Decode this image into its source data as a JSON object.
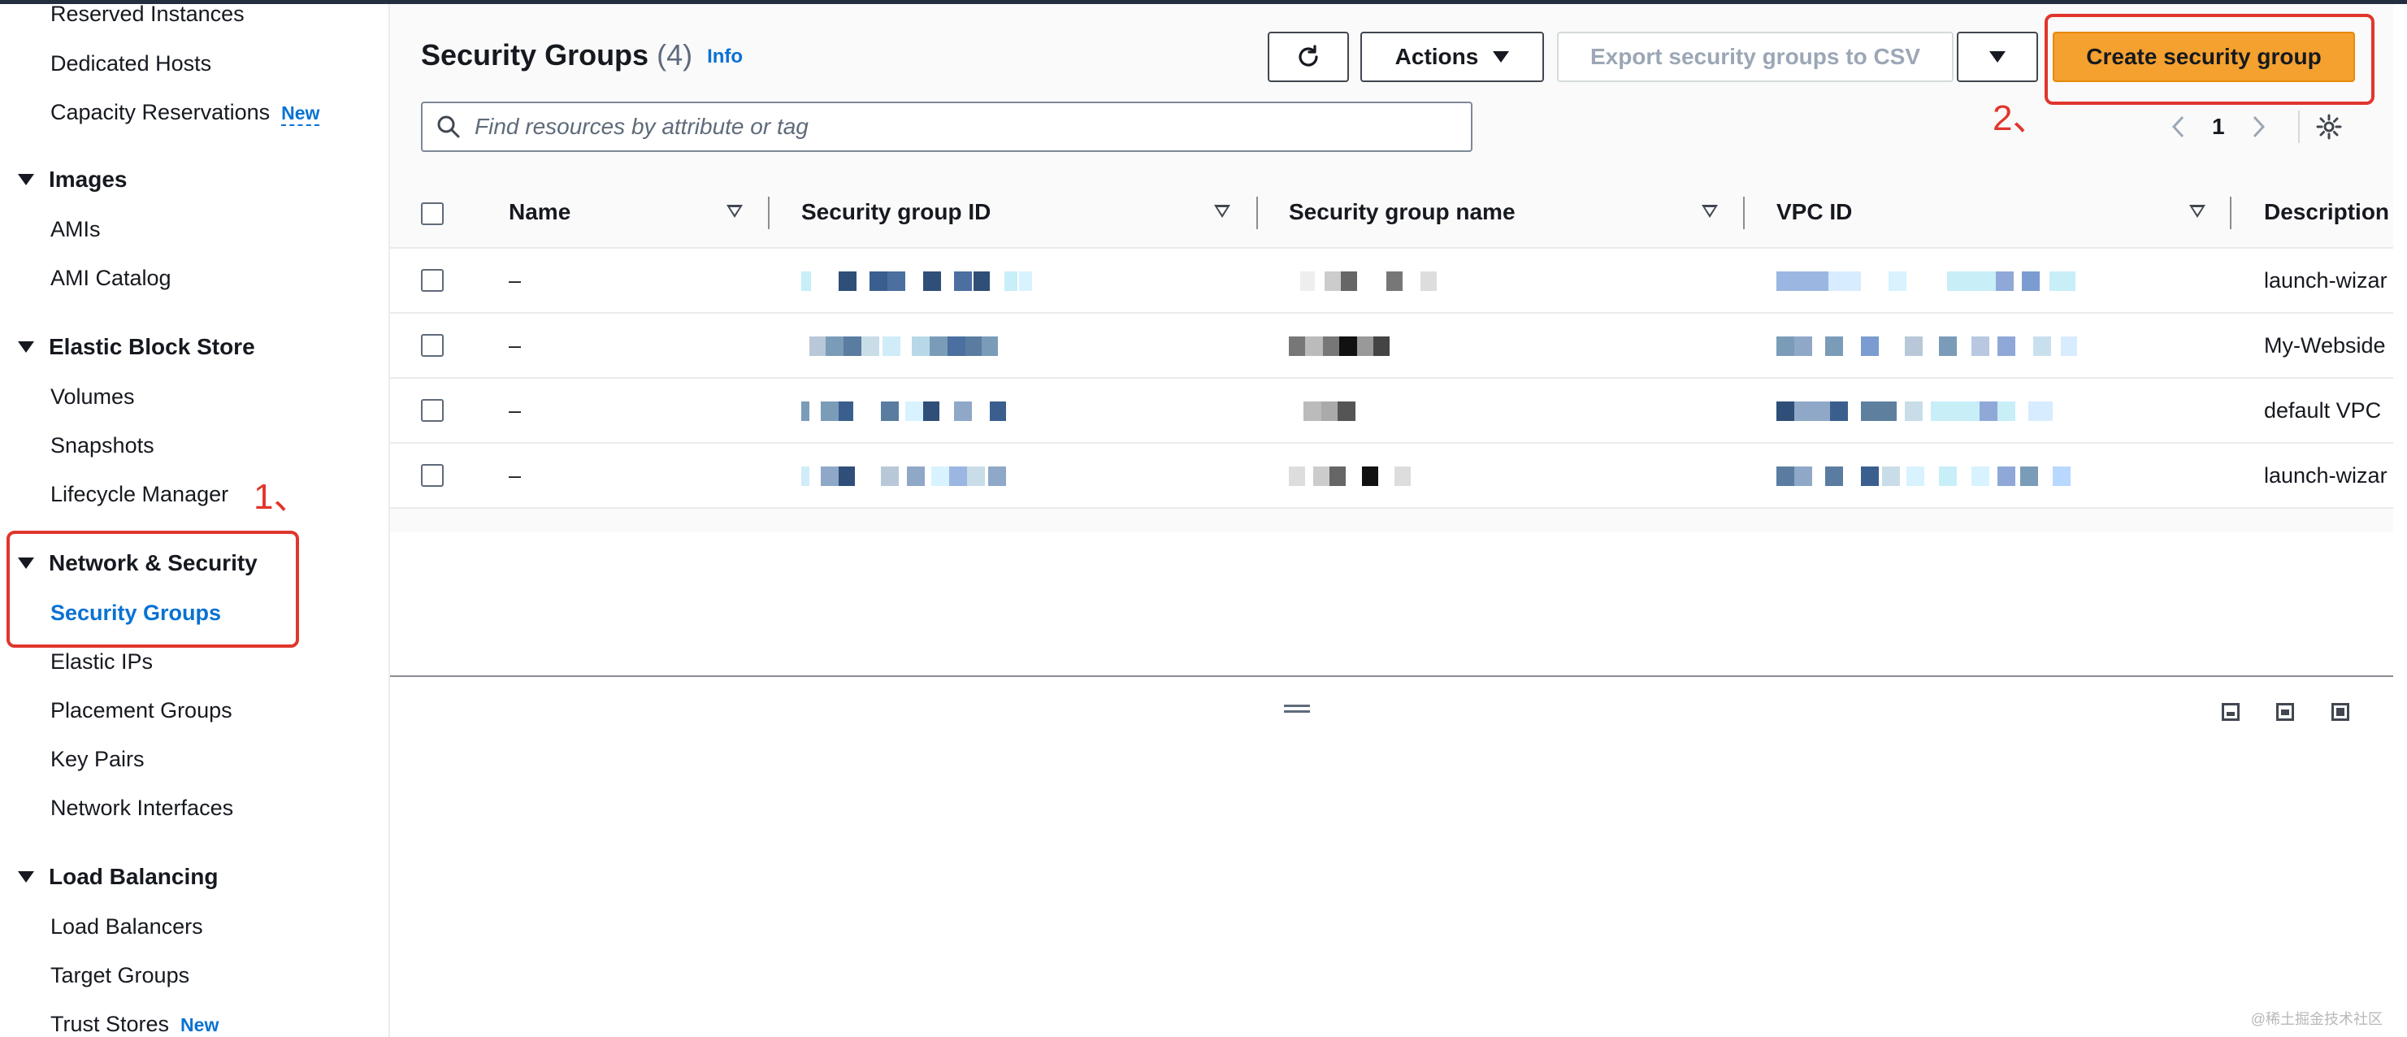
{
  "sidebar": {
    "items_top": [
      {
        "label": "Reserved Instances"
      },
      {
        "label": "Dedicated Hosts"
      },
      {
        "label": "Capacity Reservations",
        "badge": "New"
      }
    ],
    "sections": [
      {
        "title": "Images",
        "items": [
          "AMIs",
          "AMI Catalog"
        ]
      },
      {
        "title": "Elastic Block Store",
        "items": [
          "Volumes",
          "Snapshots",
          "Lifecycle Manager"
        ]
      },
      {
        "title": "Network & Security",
        "items": [
          "Security Groups",
          "Elastic IPs",
          "Placement Groups",
          "Key Pairs",
          "Network Interfaces"
        ]
      },
      {
        "title": "Load Balancing",
        "items": [
          "Load Balancers",
          "Target Groups",
          "Trust Stores"
        ],
        "badge": "New"
      }
    ],
    "active_item": "Security Groups"
  },
  "annotations": {
    "step1": "1、",
    "step2": "2、"
  },
  "main": {
    "title": "Security Groups",
    "count": "(4)",
    "info": "Info",
    "buttons": {
      "refresh_icon": "refresh-icon",
      "actions": "Actions",
      "export": "Export security groups to CSV",
      "create": "Create security group"
    },
    "search_placeholder": "Find resources by attribute or tag",
    "page_number": "1",
    "columns": [
      "Name",
      "Security group ID",
      "Security group name",
      "VPC ID",
      "Description"
    ],
    "rows": [
      {
        "name": "–",
        "description": "launch-wizar"
      },
      {
        "name": "–",
        "description": "My-Webside"
      },
      {
        "name": "–",
        "description": "default VPC"
      },
      {
        "name": "–",
        "description": "launch-wizar"
      }
    ]
  },
  "watermark": "@稀土掘金技术社区",
  "colors": {
    "accent": "#0972d3",
    "primary_button": "#f4a12f",
    "annotation": "#e0362c"
  }
}
